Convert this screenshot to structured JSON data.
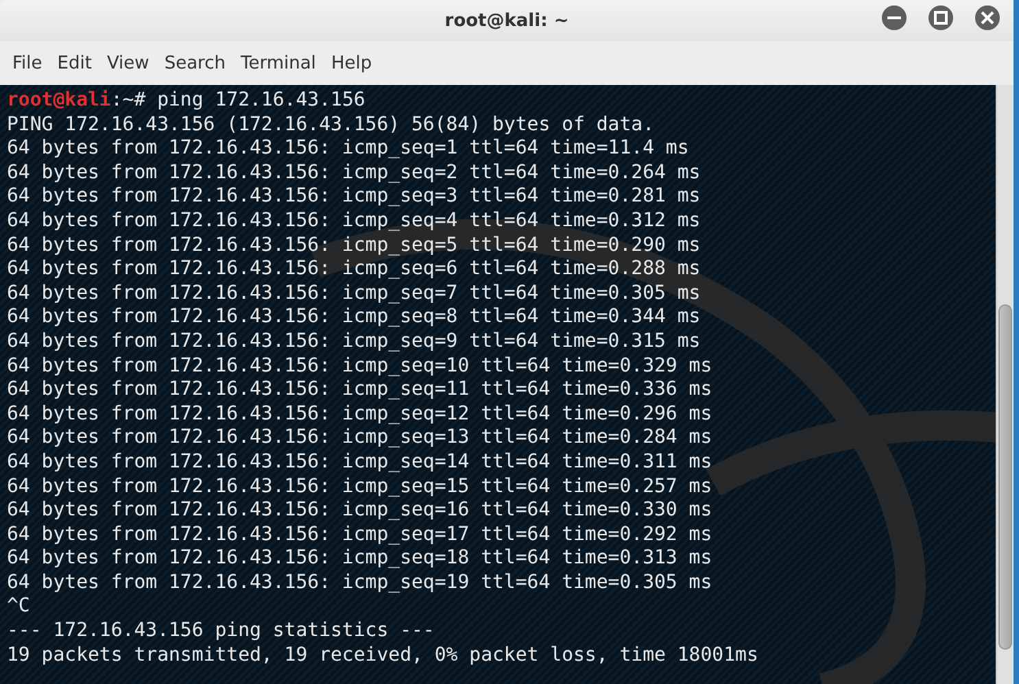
{
  "window": {
    "title": "root@kali: ~"
  },
  "menu": [
    "File",
    "Edit",
    "View",
    "Search",
    "Terminal",
    "Help"
  ],
  "terminal": {
    "prompt": {
      "user": "root@kali",
      "location": ":~# ",
      "command": "ping 172.16.43.156"
    },
    "lines": [
      "PING 172.16.43.156 (172.16.43.156) 56(84) bytes of data.",
      "64 bytes from 172.16.43.156: icmp_seq=1 ttl=64 time=11.4 ms",
      "64 bytes from 172.16.43.156: icmp_seq=2 ttl=64 time=0.264 ms",
      "64 bytes from 172.16.43.156: icmp_seq=3 ttl=64 time=0.281 ms",
      "64 bytes from 172.16.43.156: icmp_seq=4 ttl=64 time=0.312 ms",
      "64 bytes from 172.16.43.156: icmp_seq=5 ttl=64 time=0.290 ms",
      "64 bytes from 172.16.43.156: icmp_seq=6 ttl=64 time=0.288 ms",
      "64 bytes from 172.16.43.156: icmp_seq=7 ttl=64 time=0.305 ms",
      "64 bytes from 172.16.43.156: icmp_seq=8 ttl=64 time=0.344 ms",
      "64 bytes from 172.16.43.156: icmp_seq=9 ttl=64 time=0.315 ms",
      "64 bytes from 172.16.43.156: icmp_seq=10 ttl=64 time=0.329 ms",
      "64 bytes from 172.16.43.156: icmp_seq=11 ttl=64 time=0.336 ms",
      "64 bytes from 172.16.43.156: icmp_seq=12 ttl=64 time=0.296 ms",
      "64 bytes from 172.16.43.156: icmp_seq=13 ttl=64 time=0.284 ms",
      "64 bytes from 172.16.43.156: icmp_seq=14 ttl=64 time=0.311 ms",
      "64 bytes from 172.16.43.156: icmp_seq=15 ttl=64 time=0.257 ms",
      "64 bytes from 172.16.43.156: icmp_seq=16 ttl=64 time=0.330 ms",
      "64 bytes from 172.16.43.156: icmp_seq=17 ttl=64 time=0.292 ms",
      "64 bytes from 172.16.43.156: icmp_seq=18 ttl=64 time=0.313 ms",
      "64 bytes from 172.16.43.156: icmp_seq=19 ttl=64 time=0.305 ms",
      "^C",
      "--- 172.16.43.156 ping statistics ---",
      "19 packets transmitted, 19 received, 0% packet loss, time 18001ms"
    ]
  }
}
